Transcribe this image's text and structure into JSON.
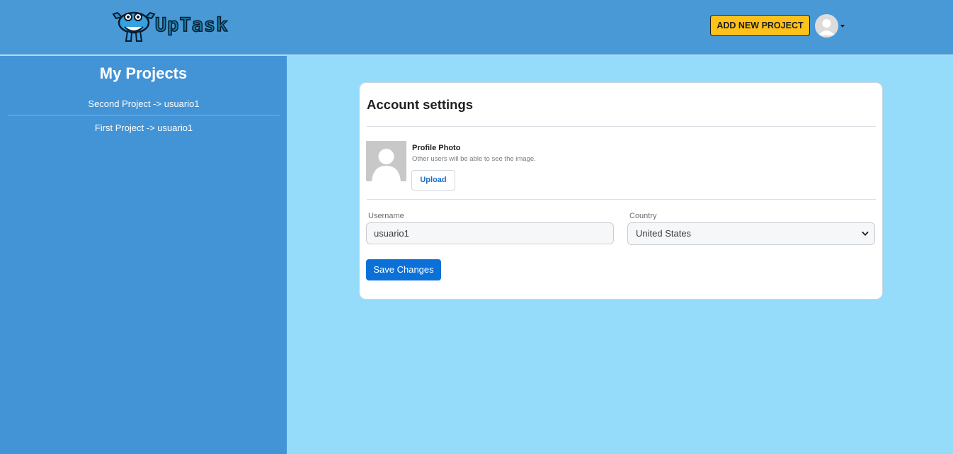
{
  "header": {
    "logo_text": "UpTask",
    "add_project_label": "ADD NEW PROJECT"
  },
  "sidebar": {
    "title": "My Projects",
    "projects": [
      {
        "label": "Second Project -> usuario1"
      },
      {
        "label": "First Project -> usuario1"
      }
    ]
  },
  "settings": {
    "title": "Account settings",
    "photo": {
      "label": "Profile Photo",
      "hint": "Other users will be able to see the image.",
      "upload_label": "Upload"
    },
    "username": {
      "label": "Username",
      "value": "usuario1"
    },
    "country": {
      "label": "Country",
      "selected": "United States"
    },
    "save_label": "Save Changes"
  },
  "icons": {
    "logo": "robot-mascot-icon",
    "avatar": "user-avatar-icon",
    "caret": "caret-down-icon",
    "select_chevron": "chevron-down-icon"
  },
  "colors": {
    "header_bg": "#4899d6",
    "sidebar_bg": "#4394d6",
    "page_bg": "#95dcfb",
    "accent_button": "#fdc11a",
    "primary_button": "#0b71d9"
  }
}
